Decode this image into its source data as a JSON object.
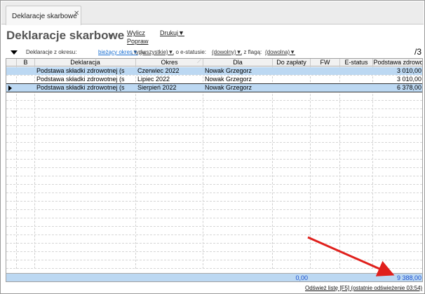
{
  "tab": {
    "label": "Deklaracje skarbowe",
    "close": "✕"
  },
  "header": {
    "title": "Deklaracje skarbowe",
    "title_arrow": "▼",
    "menu": {
      "calc": "Wylicz",
      "edit": "Popraw",
      "print": "Drukuj▼"
    }
  },
  "filters": {
    "period_label": "Deklaracje z okresu:",
    "period_value": "bieżący okres▼",
    "type_label": ", typu:",
    "type_value": "(wszystkie)▼",
    "estatus_label": ", o e-statusie:",
    "estatus_value": "(dowolny)▼",
    "flag_label": ", z flagą:",
    "flag_value": "(dowolna)▼",
    "page_count": "/3"
  },
  "table": {
    "columns": [
      "",
      "B",
      "Deklaracja",
      "Okres",
      "Dla",
      "Do zapłaty",
      "FW",
      "E-status",
      "Podstawa zdrowo"
    ],
    "rows": [
      {
        "deklaracja": "Podstawa składki zdrowotnej (s",
        "okres": "Czerwiec 2022",
        "dla": "Nowak Grzegorz",
        "podstawa": "3 010,00"
      },
      {
        "deklaracja": "Podstawa składki zdrowotnej (s",
        "okres": "Lipiec 2022",
        "dla": "Nowak Grzegorz",
        "podstawa": "3 010,00"
      },
      {
        "deklaracja": "Podstawa składki zdrowotnej (s",
        "okres": "Sierpień 2022",
        "dla": "Nowak Grzegorz",
        "podstawa": "6 378,00"
      }
    ],
    "footer": {
      "do_zaplaty": "0,00",
      "podstawa": "9 388,00"
    }
  },
  "refresh": "Odśwież listę [F5] (ostatnie odświeżenie 03:54)",
  "colors": {
    "selection": "#bcd8f2",
    "accent_blue": "#1a6fd1",
    "arrow_red": "#e0201c"
  }
}
